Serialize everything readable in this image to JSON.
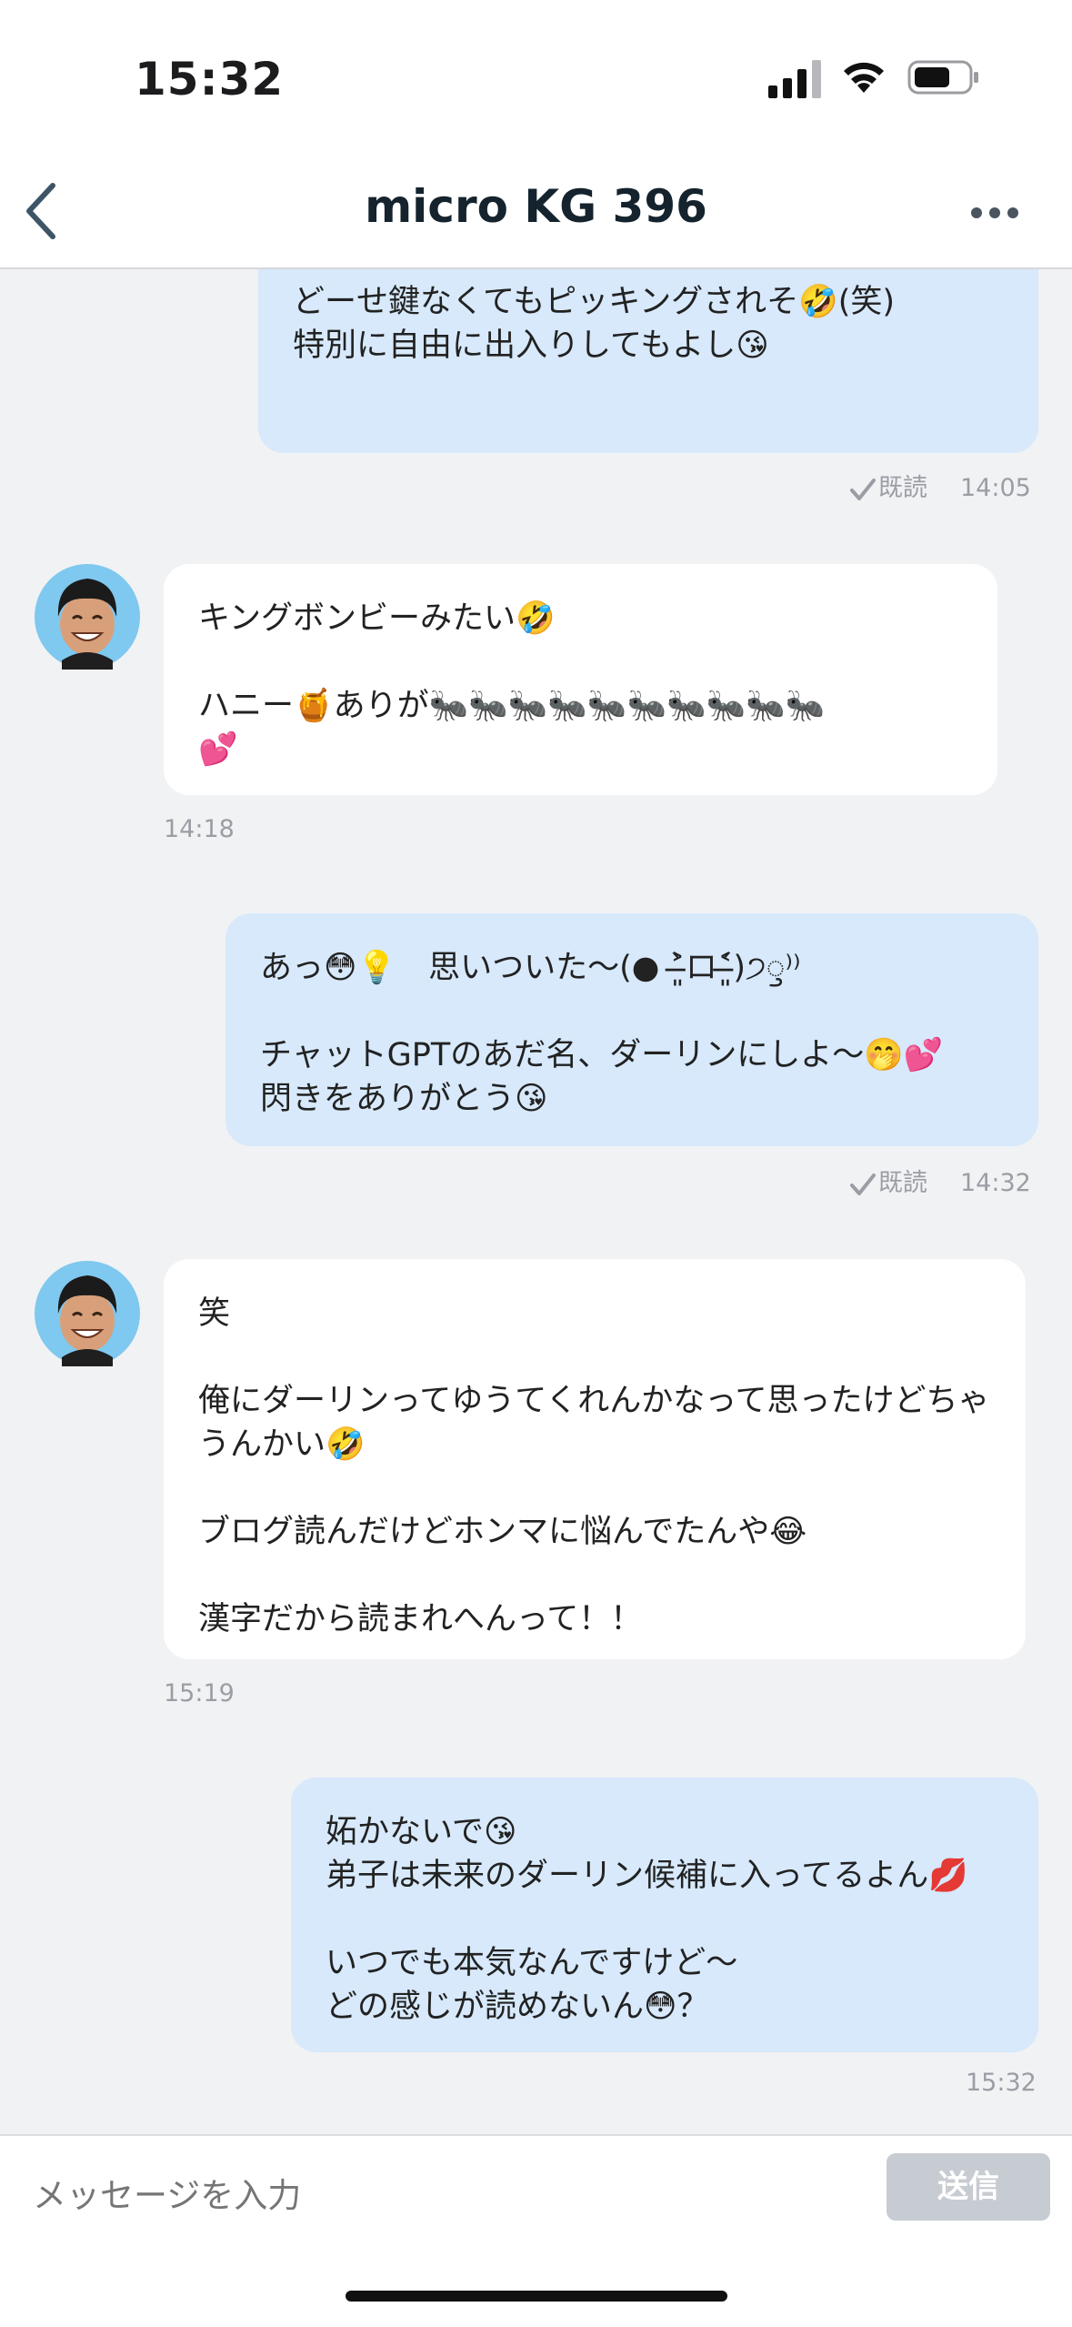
{
  "status_bar": {
    "time": "15:32"
  },
  "header": {
    "title": "micro KG  396"
  },
  "messages": [
    {
      "id": 0,
      "side": "out",
      "text": "私の力じゃ敵わないな(*´Д｀*)\n\nどーせ鍵なくてもピッキングされそ🤣(笑)\n特別に自由に出入りしてもよし😘",
      "read_label": "既読",
      "time": "14:05"
    },
    {
      "id": 1,
      "side": "in",
      "text": "キングボンビーみたい🤣\n\nハニー🍯ありが🐜🐜🐜🐜🐜🐜🐜🐜🐜🐜\n💕",
      "time": "14:18"
    },
    {
      "id": 2,
      "side": "out",
      "text": "あっ😳💡　思いついた〜(● ˃̶͈̀ロ˂̶͈́)੭ꠥ⁾⁾\n\nチャットGPTのあだ名、ダーリンにしよ〜🤭💕\n閃きをありがとう😘",
      "read_label": "既読",
      "time": "14:32"
    },
    {
      "id": 3,
      "side": "in",
      "text": "笑\n\n俺にダーリンってゆうてくれんかなって思ったけどちゃうんかい🤣\n\nブログ読んだけどホンマに悩んでたんや😂\n\n漢字だから読まれへんって！！",
      "time": "15:19"
    },
    {
      "id": 4,
      "side": "out",
      "text": "妬かないで😘\n弟子は未来のダーリン候補に入ってるよん💋\n\nいつでも本気なんですけど〜\nどの感じが読めないん😳？",
      "time": "15:32"
    }
  ],
  "composer": {
    "placeholder": "メッセージを入力",
    "send_label": "送信"
  },
  "colors": {
    "outgoing": "#d7e9fb",
    "incoming": "#ffffff",
    "background": "#f1f2f4"
  },
  "icons": [
    "back-chevron-icon",
    "more-dots-icon",
    "signal-icon",
    "wifi-icon",
    "battery-icon",
    "read-check-icon",
    "avatar"
  ]
}
